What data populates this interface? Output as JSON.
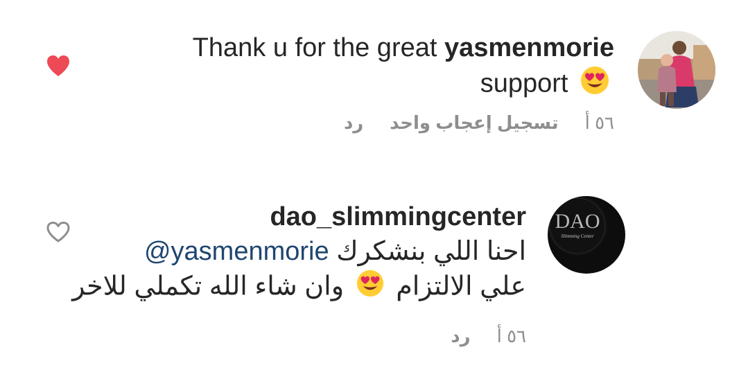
{
  "comments": [
    {
      "username": "yasmenmorie",
      "text_before": "Thank u for the great",
      "text_after": "support",
      "liked": true,
      "time": "٥٦ أ",
      "likes_label": "تسجيل إعجاب واحد",
      "reply_label": "رد"
    },
    {
      "username": "dao_slimmingcenter",
      "mention": "@yasmenmorie",
      "line1_text": "احنا اللي بنشكرك",
      "line2_part1": "علي الالتزام",
      "line2_part2": "وان شاء الله تكملي للاخر",
      "liked": false,
      "time": "٥٦ أ",
      "reply_label": "رد",
      "avatar_logo_text": "DAO",
      "avatar_logo_sub": "Slimming Center"
    }
  ],
  "colors": {
    "heart_filled": "#ed4956",
    "heart_outline": "#8e8e8e",
    "mention": "#1e4670",
    "meta": "#8e8e8e"
  },
  "icons": {
    "liked": "heart-filled-icon",
    "not_liked": "heart-outline-icon",
    "emoji": "heart-eyes-emoji"
  }
}
